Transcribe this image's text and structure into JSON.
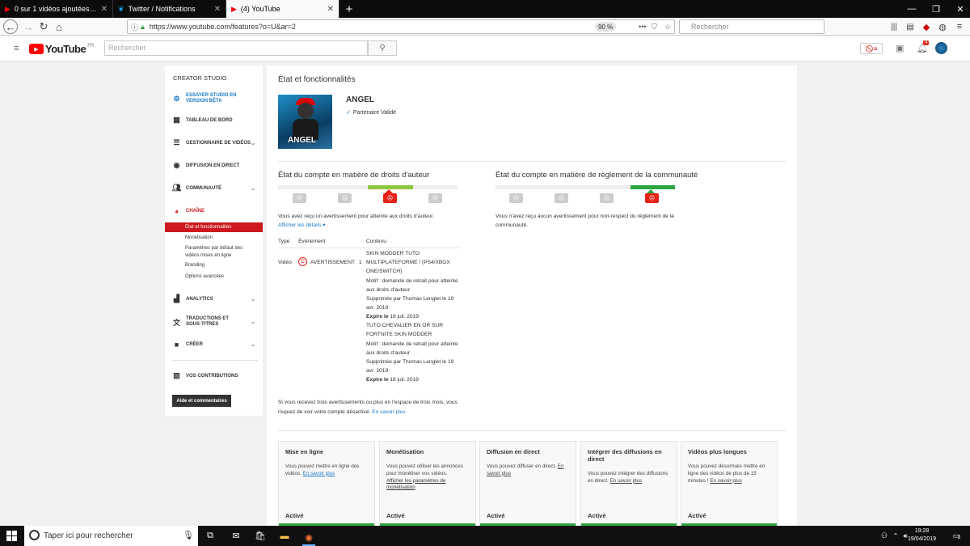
{
  "browser": {
    "tabs": [
      {
        "title": "0 sur 1 vidéos ajoutées - YouTu",
        "icon": "youtube-favicon",
        "active": false
      },
      {
        "title": "Twitter / Notifications",
        "icon": "twitter-favicon",
        "active": false
      },
      {
        "title": "(4) YouTube",
        "icon": "youtube-favicon",
        "active": true
      }
    ],
    "url": "https://www.youtube.com/features?o=U&ar=2",
    "zoom": "90 %",
    "search_placeholder": "Rechercher"
  },
  "youtube": {
    "logo_text": "YouTube",
    "logo_region": "FR",
    "search_placeholder": "Rechercher",
    "notification_count": "4"
  },
  "sidebar": {
    "title": "CREATOR STUDIO",
    "beta": "ESSAYER STUDIO EN VERSION BÊTA",
    "items": [
      {
        "label": "TABLEAU DE BORD",
        "icon": "dashboard-icon"
      },
      {
        "label": "GESTIONNAIRE DE VIDÉOS",
        "icon": "video-manager-icon"
      },
      {
        "label": "DIFFUSION EN DIRECT",
        "icon": "live-icon"
      },
      {
        "label": "COMMUNAUTÉ",
        "icon": "community-icon"
      },
      {
        "label": "CHAÎNE",
        "icon": "channel-icon"
      },
      {
        "label": "ANALYTICS",
        "icon": "analytics-icon"
      },
      {
        "label": "TRADUCTIONS ET SOUS-TITRES",
        "icon": "translate-icon"
      },
      {
        "label": "CRÉER",
        "icon": "create-icon"
      },
      {
        "label": "VOS CONTRIBUTIONS",
        "icon": "contributions-icon"
      }
    ],
    "subitems": [
      "État et fonctionnalités",
      "Monétisation",
      "Paramètres par défaut des vidéos mises en ligne",
      "Branding",
      "Options avancées"
    ],
    "help_button": "Aide et commentaires"
  },
  "main": {
    "title": "État et fonctionnalités",
    "channel_name": "ANGEL",
    "avatar_label": "ANGEL",
    "partner_status": "Partenaire Validé",
    "copyright": {
      "title": "État du compte en matière de droits d'auteur",
      "message": "Vous avez reçu un avertissement pour atteinte aux droits d'auteur.",
      "details_link": "Afficher les détails ▾",
      "col_type": "Type",
      "col_event": "Événement",
      "col_content": "Contenu",
      "row_type": "Vidéo",
      "row_event": "AVERTISSEMENT",
      "row_count": "1",
      "video1_title": "SKIN MODDER TUTO MULTIPLATEFORME ! (PS4/XBOX ONE/SWITCH)",
      "video1_reason": "Motif : demande de retrait pour atteinte aux droits d'auteur",
      "video1_removed": "Supprimée par Thomas Lenglet le 19 avr. 2019",
      "video1_expiry_label": "Expire le",
      "video1_expiry": "18 juil. 2019",
      "video2_title": "TUTO CHEVALIER EN OR SUR FORTNITE SKIN MODDER",
      "video2_reason": "Motif : demande de retrait pour atteinte aux droits d'auteur",
      "video2_removed": "Supprimée par Thomas Lenglet le 19 avr. 2019",
      "video2_expiry_label": "Expire le",
      "video2_expiry": "18 juil. 2019",
      "warning": "Si vous recevez trois avertissements ou plus en l'espace de trois mois, vous risquez de voir votre compte désactivé.",
      "warning_link": "En savoir plus"
    },
    "community": {
      "title": "État du compte en matière de règlement de la communauté",
      "message": "Vous n'avez reçu aucun avertissement pour non-respect du règlement de la communauté."
    },
    "features": [
      {
        "title": "Mise en ligne",
        "desc": "Vous pouvez mettre en ligne des vidéos.",
        "link": "En savoir plus",
        "status": "Activé"
      },
      {
        "title": "Monétisation",
        "desc": "Vous pouvez utiliser les annonces pour monétiser vos vidéos.",
        "link": "Afficher les paramètres de monétisation",
        "status": "Activé"
      },
      {
        "title": "Diffusion en direct",
        "desc": "Vous pouvez diffuser en direct.",
        "link": "En savoir plus",
        "status": "Activé"
      },
      {
        "title": "Intégrer des diffusions en direct",
        "desc": "Vous pouvez intégrer des diffusions en direct.",
        "link": "En savoir plus",
        "status": "Activé"
      },
      {
        "title": "Vidéos plus longues",
        "desc": "Vous pouvez désormais mettre en ligne des vidéos de plus de 15 minutes !",
        "link": "En savoir plus",
        "status": "Activé"
      }
    ]
  },
  "taskbar": {
    "search_placeholder": "Taper ici pour rechercher",
    "time": "19:28",
    "date": "19/04/2019",
    "notif_count": "2"
  },
  "colors": {
    "youtube_red": "#ff0000",
    "strike_red": "#e62117",
    "good_green": "#2ba640",
    "meter_yellow": "#8dc63f",
    "link_blue": "#167ac6"
  }
}
